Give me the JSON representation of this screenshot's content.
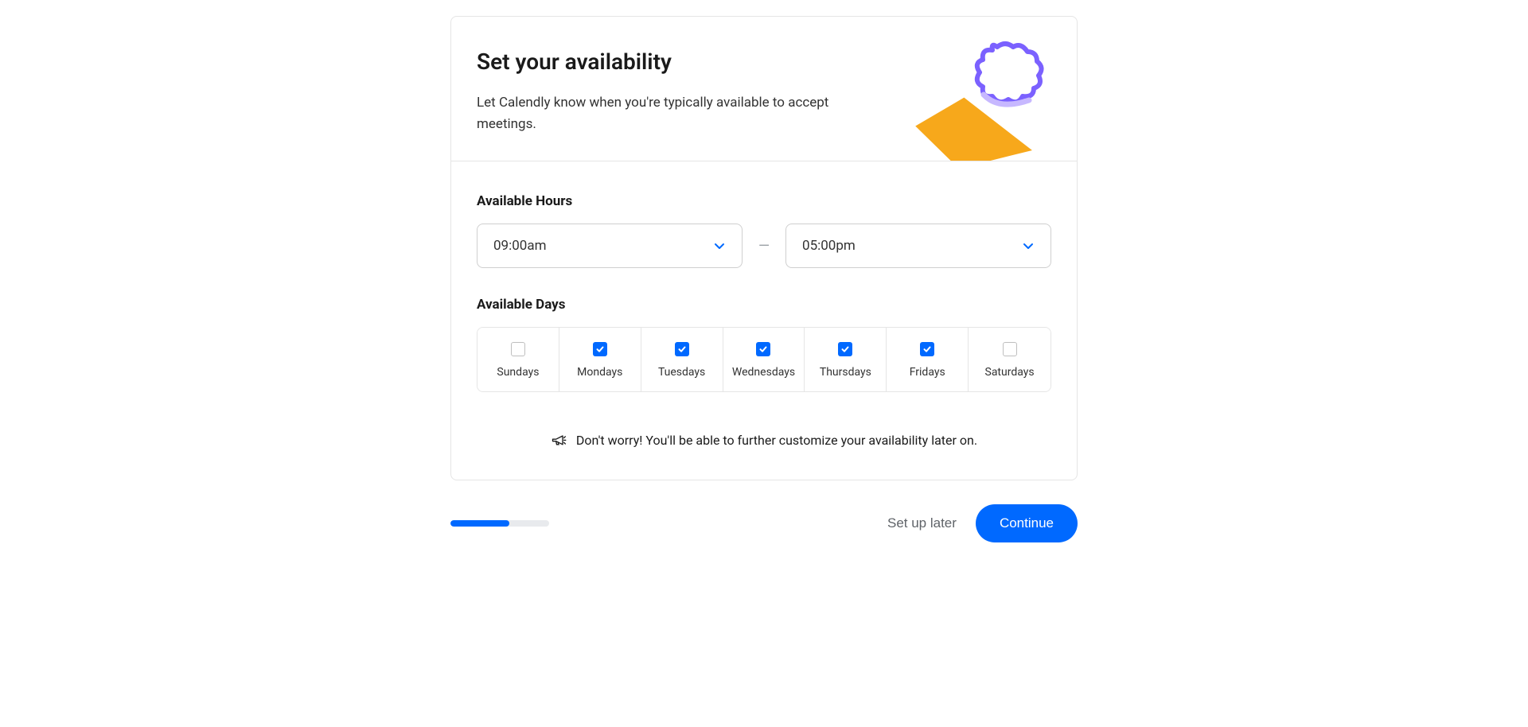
{
  "header": {
    "title": "Set your availability",
    "subtitle": "Let Calendly know when you're typically available to accept meetings."
  },
  "hours": {
    "label": "Available Hours",
    "start": "09:00am",
    "end": "05:00pm",
    "separator": "—"
  },
  "days": {
    "label": "Available Days",
    "items": [
      {
        "label": "Sundays",
        "checked": false
      },
      {
        "label": "Mondays",
        "checked": true
      },
      {
        "label": "Tuesdays",
        "checked": true
      },
      {
        "label": "Wednesdays",
        "checked": true
      },
      {
        "label": "Thursdays",
        "checked": true
      },
      {
        "label": "Fridays",
        "checked": true
      },
      {
        "label": "Saturdays",
        "checked": false
      }
    ]
  },
  "info": {
    "text": "Don't worry! You'll be able to further customize your availability later on."
  },
  "footer": {
    "progress_percent": 60,
    "setup_later_label": "Set up later",
    "continue_label": "Continue"
  },
  "colors": {
    "primary": "#0069ff",
    "illustration_orange": "#F7A81B",
    "illustration_purple": "#7B61FF"
  }
}
